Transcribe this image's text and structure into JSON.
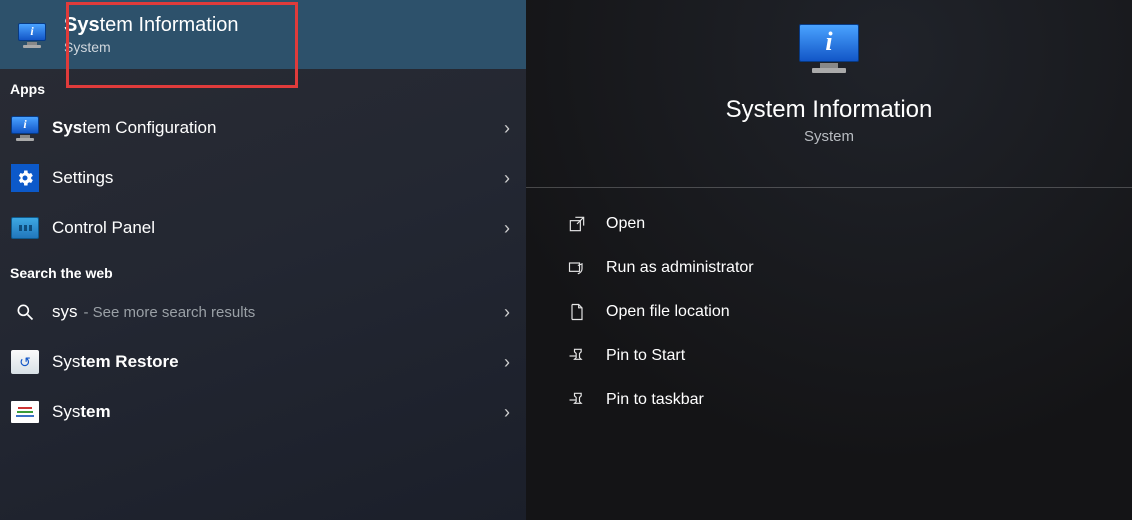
{
  "best_match": {
    "title_bold": "Sys",
    "title_rest": "tem Information",
    "subtitle": "System"
  },
  "sections": {
    "apps_header": "Apps",
    "web_header": "Search the web"
  },
  "apps": [
    {
      "bold": "Sys",
      "rest": "tem Configuration"
    },
    {
      "bold": "",
      "rest": "Settings"
    },
    {
      "bold": "",
      "rest": "Control Panel"
    }
  ],
  "web": [
    {
      "bold": "",
      "rest": "sys",
      "hint": "- See more search results"
    },
    {
      "bold": "Sys",
      "rest": "tem Restore"
    },
    {
      "bold": "Sys",
      "rest": "tem"
    }
  ],
  "detail": {
    "title": "System Information",
    "subtitle": "System"
  },
  "actions": [
    {
      "label": "Open",
      "icon": "open-icon"
    },
    {
      "label": "Run as administrator",
      "icon": "shield-icon"
    },
    {
      "label": "Open file location",
      "icon": "folder-icon"
    },
    {
      "label": "Pin to Start",
      "icon": "pin-icon"
    },
    {
      "label": "Pin to taskbar",
      "icon": "pin-icon"
    }
  ]
}
